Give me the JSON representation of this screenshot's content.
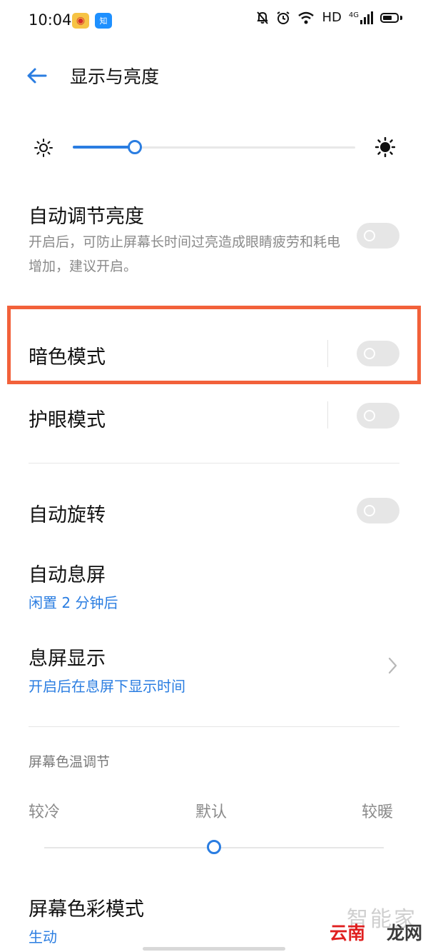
{
  "status_bar": {
    "time": "10:04",
    "zhihu_glyph": "知",
    "network": "HD",
    "signal": "4G",
    "icons": [
      "weibo-icon",
      "zhihu-icon",
      "mute-bell-icon",
      "alarm-icon",
      "wifi-icon",
      "signal-icon",
      "battery-icon"
    ]
  },
  "header": {
    "title": "显示与亮度"
  },
  "brightness": {
    "level": 0.22,
    "accent": "#2a7de1"
  },
  "auto_brightness": {
    "title": "自动调节亮度",
    "desc": "开启后，可防止屏幕长时间过亮造成眼睛疲劳和耗电增加，建议开启。",
    "enabled": false
  },
  "dark_mode": {
    "title": "暗色模式",
    "enabled": false,
    "highlight_color": "#f2613a"
  },
  "eye_care": {
    "title": "护眼模式",
    "enabled": false
  },
  "auto_rotate": {
    "title": "自动旋转",
    "enabled": false
  },
  "screen_timeout": {
    "title": "自动息屏",
    "value": "闲置 2 分钟后"
  },
  "aod": {
    "title": "息屏显示",
    "desc": "开启后在息屏下显示时间"
  },
  "color_temp": {
    "section": "屏幕色温调节",
    "labels": [
      "较冷",
      "默认",
      "较暖"
    ],
    "level": 0.5
  },
  "color_mode": {
    "title": "屏幕色彩模式",
    "value": "生动"
  },
  "watermark": {
    "a": "智能家",
    "b": "云南",
    "c": "龙网"
  }
}
